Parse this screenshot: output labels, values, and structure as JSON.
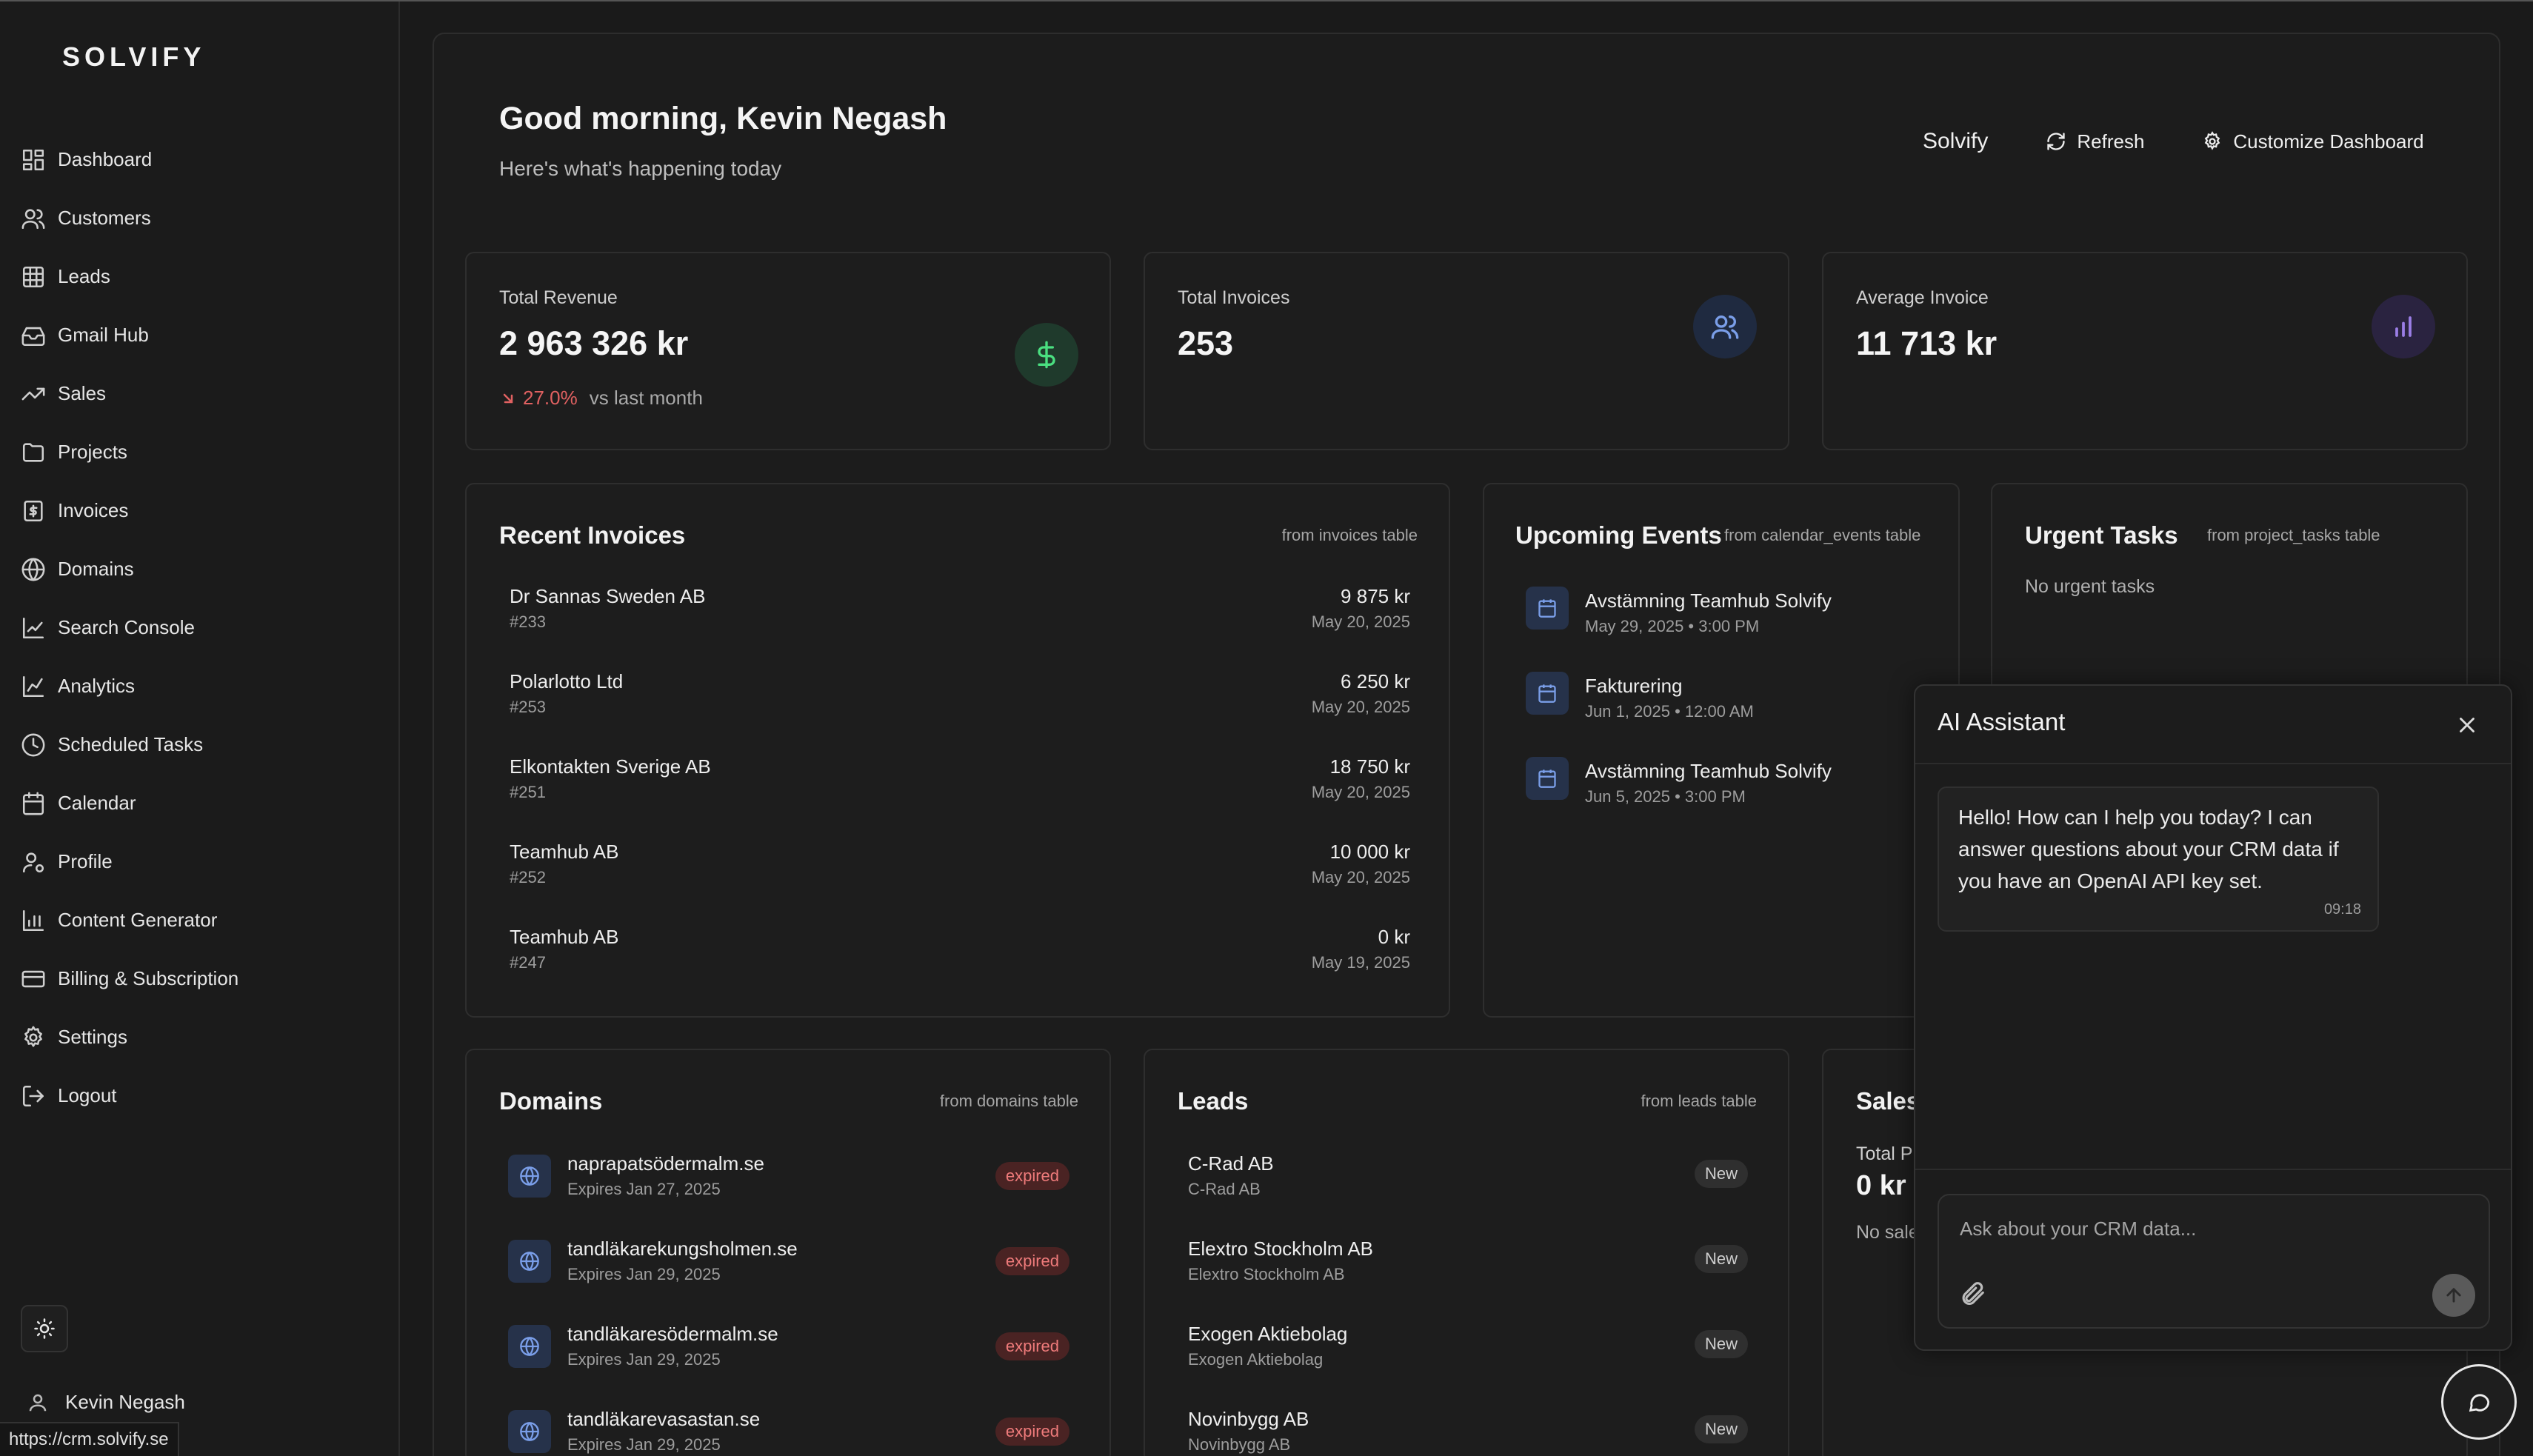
{
  "app": {
    "logo": "SOLVIFY"
  },
  "sidebar": {
    "items": [
      {
        "label": "Dashboard",
        "icon": "dashboard-icon"
      },
      {
        "label": "Customers",
        "icon": "users-icon"
      },
      {
        "label": "Leads",
        "icon": "grid-icon"
      },
      {
        "label": "Gmail Hub",
        "icon": "inbox-icon"
      },
      {
        "label": "Sales",
        "icon": "trending-up-icon"
      },
      {
        "label": "Projects",
        "icon": "folder-icon"
      },
      {
        "label": "Invoices",
        "icon": "invoice-icon"
      },
      {
        "label": "Domains",
        "icon": "globe-icon"
      },
      {
        "label": "Search Console",
        "icon": "line-chart-icon"
      },
      {
        "label": "Analytics",
        "icon": "analytics-icon"
      },
      {
        "label": "Scheduled Tasks",
        "icon": "clock-icon"
      },
      {
        "label": "Calendar",
        "icon": "calendar-icon"
      },
      {
        "label": "Profile",
        "icon": "user-gear-icon"
      },
      {
        "label": "Content Generator",
        "icon": "bar-chart-icon"
      },
      {
        "label": "Billing & Subscription",
        "icon": "credit-card-icon"
      },
      {
        "label": "Settings",
        "icon": "gear-icon"
      },
      {
        "label": "Logout",
        "icon": "logout-icon"
      }
    ],
    "user_name": "Kevin Negash"
  },
  "status_bar": {
    "url": "https://crm.solvify.se"
  },
  "header": {
    "greeting": "Good morning, Kevin Negash",
    "subtitle": "Here's what's happening today",
    "workspace": "Solvify",
    "refresh_label": "Refresh",
    "customize_label": "Customize Dashboard"
  },
  "stats": {
    "revenue": {
      "label": "Total Revenue",
      "value": "2 963 326 kr",
      "change": "27.0%",
      "vs": "vs last month"
    },
    "invoices": {
      "label": "Total Invoices",
      "value": "253"
    },
    "average": {
      "label": "Average Invoice",
      "value": "11 713 kr"
    }
  },
  "recent_invoices": {
    "title": "Recent Invoices",
    "source": "from invoices table",
    "rows": [
      {
        "name": "Dr Sannas Sweden AB",
        "id": "#233",
        "amount": "9 875 kr",
        "date": "May 20, 2025"
      },
      {
        "name": "Polarlotto Ltd",
        "id": "#253",
        "amount": "6 250 kr",
        "date": "May 20, 2025"
      },
      {
        "name": "Elkontakten Sverige AB",
        "id": "#251",
        "amount": "18 750 kr",
        "date": "May 20, 2025"
      },
      {
        "name": "Teamhub AB",
        "id": "#252",
        "amount": "10 000 kr",
        "date": "May 20, 2025"
      },
      {
        "name": "Teamhub AB",
        "id": "#247",
        "amount": "0 kr",
        "date": "May 19, 2025"
      }
    ]
  },
  "upcoming_events": {
    "title": "Upcoming Events",
    "source": "from calendar_events table",
    "rows": [
      {
        "title": "Avstämning Teamhub Solvify",
        "date": "May 29, 2025 • 3:00 PM"
      },
      {
        "title": "Fakturering",
        "date": "Jun 1, 2025 • 12:00 AM"
      },
      {
        "title": "Avstämning Teamhub Solvify",
        "date": "Jun 5, 2025 • 3:00 PM"
      }
    ]
  },
  "urgent_tasks": {
    "title": "Urgent Tasks",
    "source": "from project_tasks table",
    "empty": "No urgent tasks"
  },
  "domains": {
    "title": "Domains",
    "source": "from domains table",
    "rows": [
      {
        "name": "naprapatsödermalm.se",
        "expires": "Expires Jan 27, 2025",
        "status": "expired"
      },
      {
        "name": "tandläkarekungsholmen.se",
        "expires": "Expires Jan 29, 2025",
        "status": "expired"
      },
      {
        "name": "tandläkaresödermalm.se",
        "expires": "Expires Jan 29, 2025",
        "status": "expired"
      },
      {
        "name": "tandläkarevasastan.se",
        "expires": "Expires Jan 29, 2025",
        "status": "expired"
      }
    ]
  },
  "leads": {
    "title": "Leads",
    "source": "from leads table",
    "rows": [
      {
        "name": "C-Rad AB",
        "company": "C-Rad AB",
        "status": "New"
      },
      {
        "name": "Elextro Stockholm AB",
        "company": "Elextro Stockholm AB",
        "status": "New"
      },
      {
        "name": "Exogen Aktiebolag",
        "company": "Exogen Aktiebolag",
        "status": "New"
      },
      {
        "name": "Novinbygg AB",
        "company": "Novinbygg AB",
        "status": "New"
      }
    ]
  },
  "sales": {
    "title": "Sales",
    "total_label": "Total P",
    "total_value": "0 kr",
    "empty": "No sale"
  },
  "assistant": {
    "title": "AI Assistant",
    "message": "Hello! How can I help you today? I can answer questions about your CRM data if you have an OpenAI API key set.",
    "time": "09:18",
    "placeholder": "Ask about your CRM data..."
  },
  "colors": {
    "revenue_icon_bg": "#1f3a2c",
    "revenue_icon_fg": "#4ade80",
    "invoices_icon_bg": "#1f2a40",
    "invoices_icon_fg": "#7a9ee8",
    "average_icon_bg": "#2a2340",
    "average_icon_fg": "#9b7ee6",
    "negative": "#e06161"
  }
}
